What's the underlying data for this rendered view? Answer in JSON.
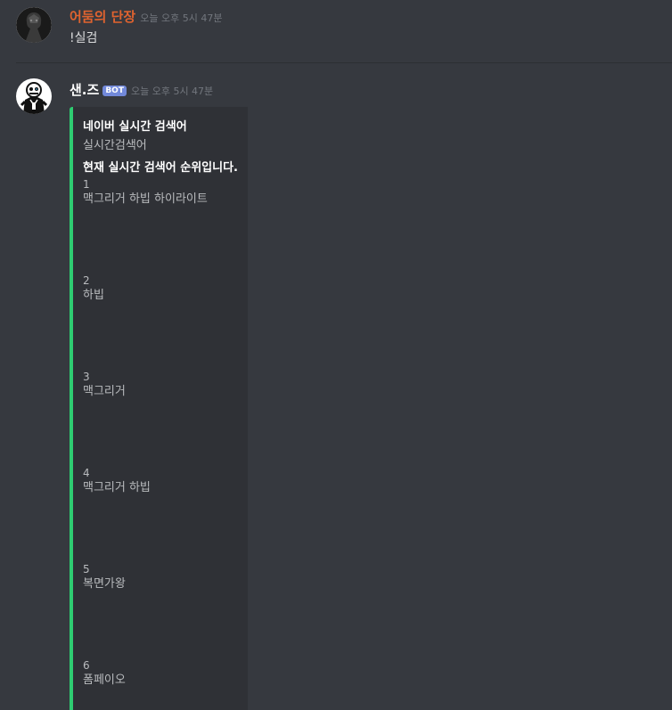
{
  "messages": [
    {
      "author": "어둠의 단장",
      "author_color": "#e0632f",
      "timestamp": "오늘 오후 5시 47분",
      "content": "!실검"
    },
    {
      "author": "샌.즈",
      "author_color": "#ffffff",
      "bot_tag": "BOT",
      "timestamp": "오늘 오후 5시 47분",
      "embed": {
        "accent_color": "#2ecc71",
        "title": "네이버 실시간 검색어",
        "description": "실시간검색어",
        "field_name": "현재 실시간 검색어 순위입니다.",
        "ranks": [
          {
            "num": "1",
            "term": "맥그리거 하빕 하이라이트"
          },
          {
            "num": "2",
            "term": "하빕"
          },
          {
            "num": "3",
            "term": "맥그리거"
          },
          {
            "num": "4",
            "term": "맥그리거 하빕"
          },
          {
            "num": "5",
            "term": "복면가왕"
          },
          {
            "num": "6",
            "term": "폼페이오"
          }
        ]
      }
    }
  ]
}
